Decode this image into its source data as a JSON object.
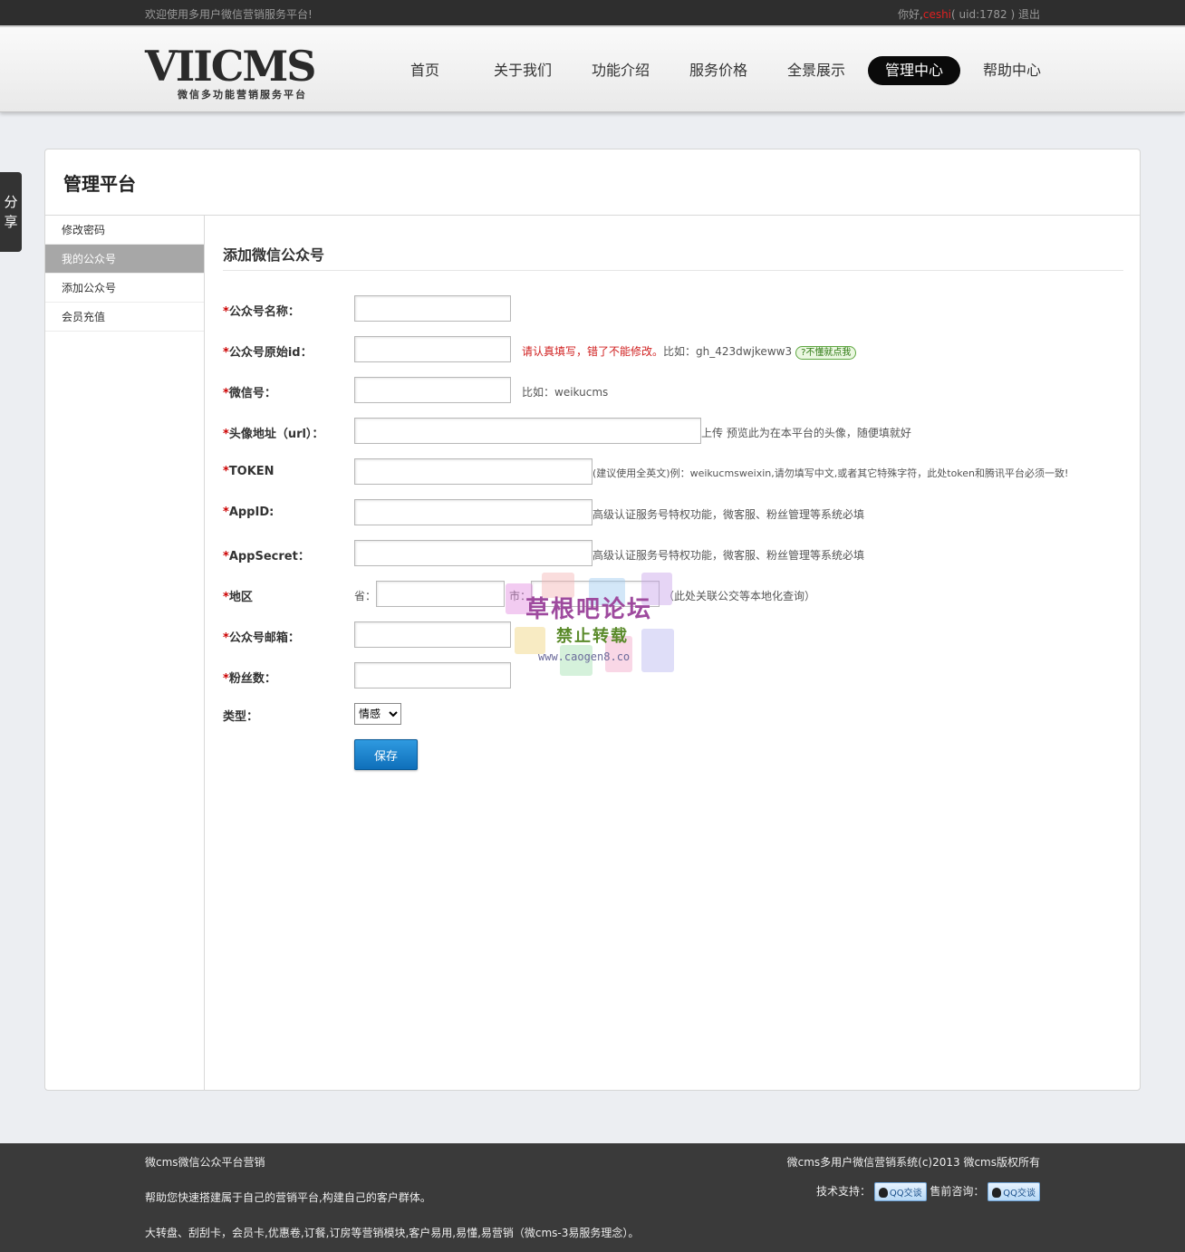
{
  "topbar": {
    "welcome": "欢迎使用多用户微信营销服务平台!",
    "greeting": "你好,",
    "username": "ceshi",
    "uid": "( uid:1782 )",
    "logout": "退出"
  },
  "logo": {
    "mark": "VIICMS",
    "subtitle": "微信多功能营销服务平台"
  },
  "nav": [
    {
      "label": "首页",
      "active": false
    },
    {
      "label": "关于我们",
      "active": false
    },
    {
      "label": "功能介绍",
      "active": false
    },
    {
      "label": "服务价格",
      "active": false
    },
    {
      "label": "全景展示",
      "active": false
    },
    {
      "label": "管理中心",
      "active": true
    },
    {
      "label": "帮助中心",
      "active": false
    }
  ],
  "share": {
    "label1": "分",
    "label2": "享"
  },
  "panel": {
    "title": "管理平台"
  },
  "sidebar": [
    {
      "label": "修改密码",
      "active": false
    },
    {
      "label": "我的公众号",
      "active": true
    },
    {
      "label": "添加公众号",
      "active": false
    },
    {
      "label": "会员充值",
      "active": false
    }
  ],
  "form": {
    "title": "添加微信公众号",
    "required_mark": "*",
    "fields": {
      "name": {
        "label": "公众号名称：",
        "value": ""
      },
      "orig_id": {
        "label": "公众号原始id：",
        "value": "",
        "hint_red": "请认真填写，错了不能修改。",
        "hint_example": "比如：gh_423dwjkeww3",
        "help": "?不懂就点我"
      },
      "wechat": {
        "label": "微信号：",
        "value": "",
        "hint": "比如：weikucms"
      },
      "avatar": {
        "label": "头像地址（url）：",
        "value": "",
        "upload": "上传",
        "preview": "预览",
        "hint": "此为在本平台的头像，随便填就好"
      },
      "token": {
        "label": "TOKEN",
        "value": "",
        "hint": "(建议使用全英文)例：weikucmsweixin,请勿填写中文,或者其它特殊字符，此处token和腾讯平台必须一致!"
      },
      "appid": {
        "label": "AppID:",
        "value": "",
        "hint": "高级认证服务号特权功能，微客服、粉丝管理等系统必填"
      },
      "appsecret": {
        "label": "AppSecret：",
        "value": "",
        "hint": "高级认证服务号特权功能，微客服、粉丝管理等系统必填"
      },
      "region": {
        "label": "地区",
        "province_label": "省：",
        "province_value": "",
        "city_label": "市：",
        "city_value": "",
        "hint": "（此处关联公交等本地化查询）"
      },
      "email": {
        "label": "公众号邮箱：",
        "value": ""
      },
      "fans": {
        "label": "粉丝数：",
        "value": ""
      },
      "type": {
        "label": "类型：",
        "selected": "情感"
      }
    },
    "save_label": "保存"
  },
  "watermark": {
    "line1": "草根吧论坛",
    "line2": "禁止转载",
    "line3": "www.caogen8.co"
  },
  "footer": {
    "left1": "微cms微信公众平台营销",
    "left2": "帮助您快速搭建属于自己的营销平台,构建自己的客户群体。",
    "left3": "大转盘、刮刮卡，会员卡,优惠卷,订餐,订房等营销模块,客户易用,易懂,易营销（微cms-3易服务理念）。",
    "copyright": "微cms多用户微信营销系统(c)2013 微cms版权所有",
    "tech_label": "技术支持：",
    "presale_label": "售前咨询：",
    "qq_label": "QQ交谈"
  }
}
